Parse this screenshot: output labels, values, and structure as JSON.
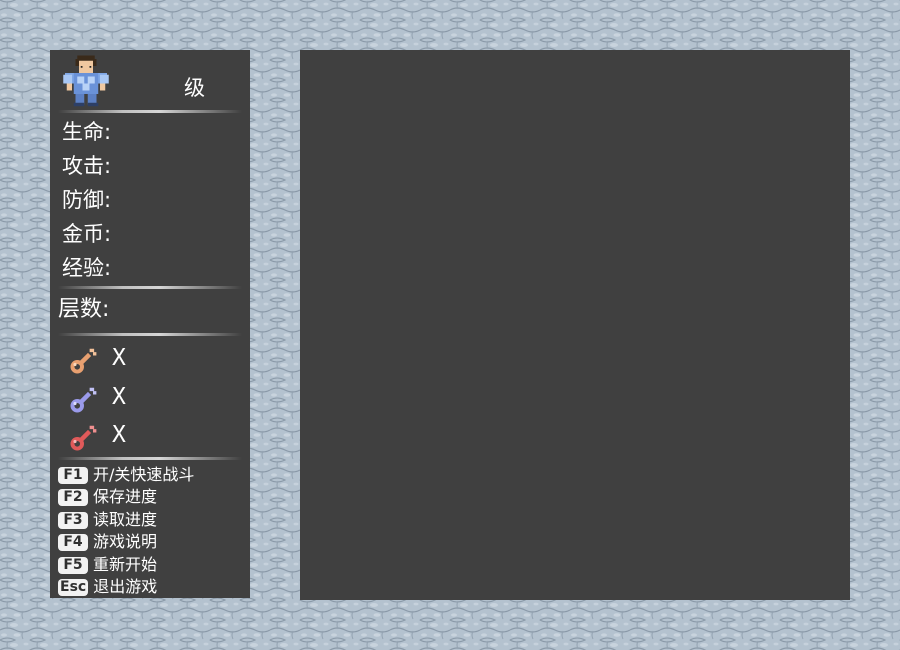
{
  "hero": {
    "level_value": "",
    "level_label": "级"
  },
  "stats": [
    {
      "label": "生命",
      "value": ""
    },
    {
      "label": "攻击",
      "value": ""
    },
    {
      "label": "防御",
      "value": ""
    },
    {
      "label": "金币",
      "value": ""
    },
    {
      "label": "经验",
      "value": ""
    }
  ],
  "stat_colon": ":",
  "floor": {
    "label": "层数",
    "colon": ":",
    "value": ""
  },
  "keys": [
    {
      "name": "yellow-key",
      "color": "#e8a070",
      "x": "X",
      "count": ""
    },
    {
      "name": "blue-key",
      "color": "#9a9aea",
      "x": "X",
      "count": ""
    },
    {
      "name": "red-key",
      "color": "#e05a5a",
      "x": "X",
      "count": ""
    }
  ],
  "hotkeys": [
    {
      "key": "F1",
      "label": "开/关快速战斗"
    },
    {
      "key": "F2",
      "label": "保存进度"
    },
    {
      "key": "F3",
      "label": "读取进度"
    },
    {
      "key": "F4",
      "label": "游戏说明"
    },
    {
      "key": "F5",
      "label": "重新开始"
    },
    {
      "key": "Esc",
      "label": "退出游戏"
    }
  ],
  "colors": {
    "panel": "#404040",
    "background_stone": "#b9c6d3",
    "text": "#ffffff"
  }
}
